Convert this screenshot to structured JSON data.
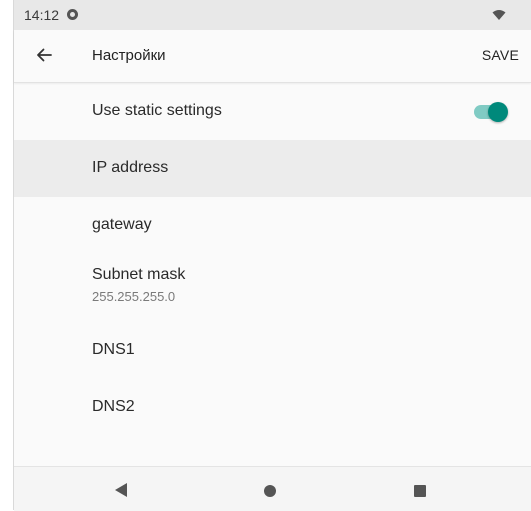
{
  "status_bar": {
    "time": "14:12",
    "app_icon": "notification-app-icon",
    "wifi_icon": "wifi-icon"
  },
  "app_bar": {
    "back_icon": "arrow-left-icon",
    "title": "Настройки",
    "save_label": "SAVE"
  },
  "settings": {
    "static_toggle": {
      "label": "Use static settings",
      "checked": true,
      "accent": "#00897b"
    },
    "items": [
      {
        "title": "IP address",
        "value": ""
      },
      {
        "title": "gateway",
        "value": ""
      },
      {
        "title": "Subnet mask",
        "value": "255.255.255.0"
      },
      {
        "title": "DNS1",
        "value": ""
      },
      {
        "title": "DNS2",
        "value": ""
      }
    ]
  },
  "nav_bar": {
    "back": "triangle-back-icon",
    "home": "circle-home-icon",
    "recents": "square-recents-icon"
  }
}
